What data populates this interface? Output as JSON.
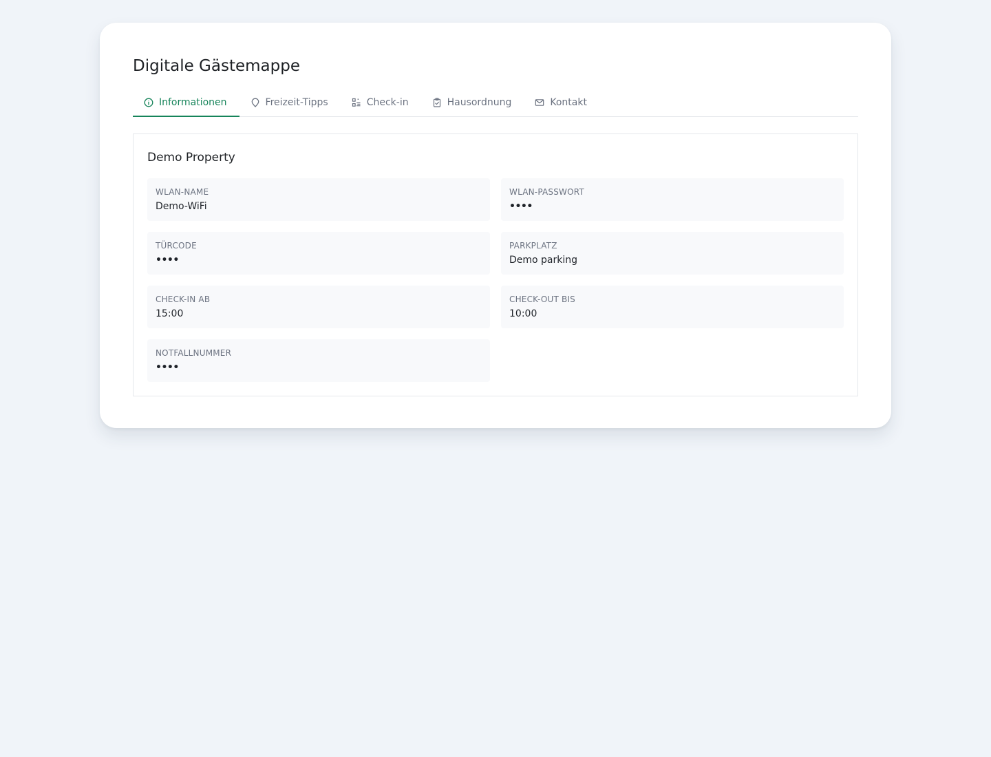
{
  "app": {
    "title": "Digitale Gästemappe"
  },
  "colors": {
    "accent": "#16845a",
    "muted_text": "#6b7280",
    "page_background": "#f0f4f9",
    "field_background": "#f8f9fb"
  },
  "tabs": [
    {
      "label": "Informationen",
      "icon": "info-icon",
      "active": true
    },
    {
      "label": "Freizeit-Tipps",
      "icon": "map-pin-icon",
      "active": false
    },
    {
      "label": "Check-in",
      "icon": "qr-code-icon",
      "active": false
    },
    {
      "label": "Hausordnung",
      "icon": "clipboard-check-icon",
      "active": false
    },
    {
      "label": "Kontakt",
      "icon": "mail-icon",
      "active": false
    }
  ],
  "property": {
    "name": "Demo Property",
    "fields": [
      {
        "label": "WLAN-Name",
        "value": "Demo-WiFi"
      },
      {
        "label": "WLAN-Passwort",
        "value": "••••"
      },
      {
        "label": "Türcode",
        "value": "••••"
      },
      {
        "label": "Parkplatz",
        "value": "Demo parking"
      },
      {
        "label": "Check-in ab",
        "value": "15:00"
      },
      {
        "label": "Check-out bis",
        "value": "10:00"
      },
      {
        "label": "Notfallnummer",
        "value": "••••"
      }
    ]
  }
}
